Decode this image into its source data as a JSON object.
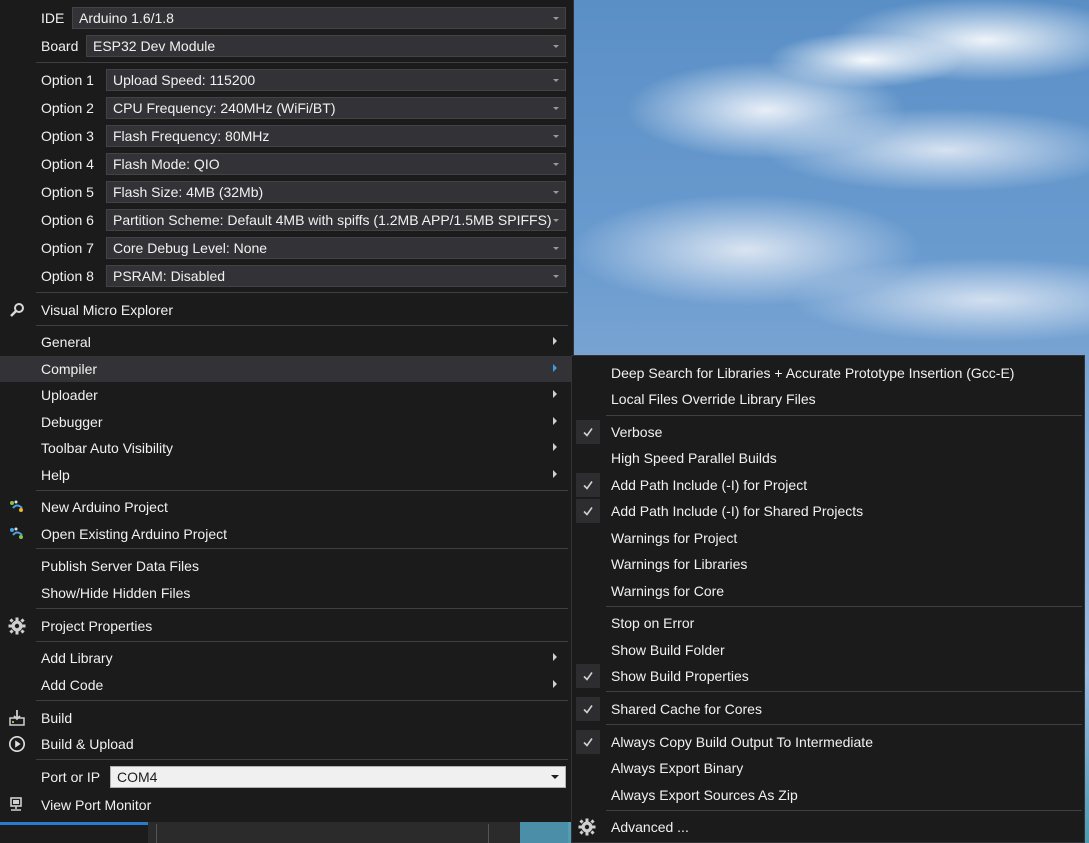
{
  "menu": {
    "ide": {
      "label": "IDE",
      "value": "Arduino 1.6/1.8"
    },
    "board": {
      "label": "Board",
      "value": "ESP32 Dev Module"
    },
    "options": [
      {
        "label": "Option 1",
        "value": "Upload Speed: 115200"
      },
      {
        "label": "Option 2",
        "value": "CPU Frequency: 240MHz (WiFi/BT)"
      },
      {
        "label": "Option 3",
        "value": "Flash Frequency: 80MHz"
      },
      {
        "label": "Option 4",
        "value": "Flash Mode: QIO"
      },
      {
        "label": "Option 5",
        "value": "Flash Size: 4MB (32Mb)"
      },
      {
        "label": "Option 6",
        "value": "Partition Scheme: Default 4MB with spiffs (1.2MB APP/1.5MB SPIFFS)"
      },
      {
        "label": "Option 7",
        "value": "Core Debug Level: None"
      },
      {
        "label": "Option 8",
        "value": "PSRAM: Disabled"
      }
    ],
    "visual_micro_explorer": "Visual Micro Explorer",
    "submenus": [
      {
        "label": "General"
      },
      {
        "label": "Compiler"
      },
      {
        "label": "Uploader"
      },
      {
        "label": "Debugger"
      },
      {
        "label": "Toolbar Auto Visibility"
      },
      {
        "label": "Help"
      }
    ],
    "new_project": "New Arduino Project",
    "open_project": "Open Existing Arduino Project",
    "publish_server_data": "Publish Server Data Files",
    "show_hide_hidden": "Show/Hide Hidden Files",
    "project_properties": "Project Properties",
    "add_library": "Add Library",
    "add_code": "Add Code",
    "build": "Build",
    "build_upload": "Build & Upload",
    "port": {
      "label": "Port or IP",
      "value": "COM4"
    },
    "view_port_monitor": "View Port Monitor"
  },
  "compiler_submenu": {
    "items": [
      {
        "label": "Deep Search for Libraries + Accurate Prototype Insertion (Gcc-E)",
        "checked": false
      },
      {
        "label": "Local Files Override Library Files",
        "checked": false
      },
      {
        "label": "Verbose",
        "checked": true
      },
      {
        "label": "High Speed Parallel Builds",
        "checked": false
      },
      {
        "label": "Add Path Include (-I) for Project",
        "checked": true
      },
      {
        "label": "Add Path Include (-I) for Shared Projects",
        "checked": true
      },
      {
        "label": "Warnings for Project",
        "checked": false
      },
      {
        "label": "Warnings for Libraries",
        "checked": false
      },
      {
        "label": "Warnings for Core",
        "checked": false
      },
      {
        "label": "Stop on Error",
        "checked": false
      },
      {
        "label": "Show Build Folder",
        "checked": false
      },
      {
        "label": "Show Build Properties",
        "checked": true
      },
      {
        "label": "Shared Cache for Cores",
        "checked": true
      },
      {
        "label": "Always Copy Build Output To Intermediate",
        "checked": true
      },
      {
        "label": "Always Export Binary",
        "checked": false
      },
      {
        "label": "Always Export Sources As Zip",
        "checked": false
      },
      {
        "label": "Advanced ...",
        "checked": false
      }
    ],
    "check_glyph": "✓"
  },
  "colors": {
    "menu_bg": "#1b1b1c",
    "hover_bg": "#333337",
    "accent": "#3e9ae6"
  }
}
